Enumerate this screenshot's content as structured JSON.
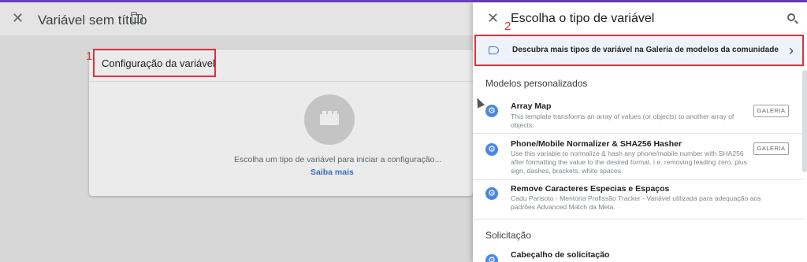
{
  "left": {
    "title": "Variável sem título",
    "close_icon": "close-icon",
    "folder_icon": "folder-icon",
    "card": {
      "title": "Configuração da variável",
      "prompt": "Escolha um tipo de variável para iniciar a configuração...",
      "link": "Saiba mais",
      "icon": "brick-icon"
    }
  },
  "annotations": {
    "one": "1",
    "two": "2"
  },
  "panel": {
    "title": "Escolha o tipo de variável",
    "search_icon": "search-icon",
    "gallery_row": {
      "label": "Descubra mais tipos de variável na Galeria de modelos da comunidade",
      "icon": "tag-icon",
      "chevron": "›"
    },
    "sections": [
      {
        "title": "Modelos personalizados",
        "items": [
          {
            "name": "Array Map",
            "desc": "This template transforms an array of values (or objects) to another array of objects.",
            "badge": "GALERIA"
          },
          {
            "name": "Phone/Mobile Normalizer & SHA256 Hasher",
            "desc": "Use this variable to normalize & hash any phone/mobile number with SHA256 after formatting the value to the desired format. i.e. removing leading zero, plus sign, dashes, brackets, white spaces.",
            "badge": "GALERIA"
          },
          {
            "name": "Remove Caracteres Especias e Espaços",
            "desc": "Cadu Parisoto - Mentoria Profissão Tracker - Variável utilizada para adequação aos padrões Advanced Match da Meta."
          }
        ]
      },
      {
        "title": "Solicitação",
        "items": [
          {
            "name": "Cabeçalho de solicitação"
          }
        ]
      }
    ]
  },
  "colors": {
    "accent": "#4a86e8",
    "annotation": "#e0303a",
    "topbar": "#6a3fb5"
  }
}
